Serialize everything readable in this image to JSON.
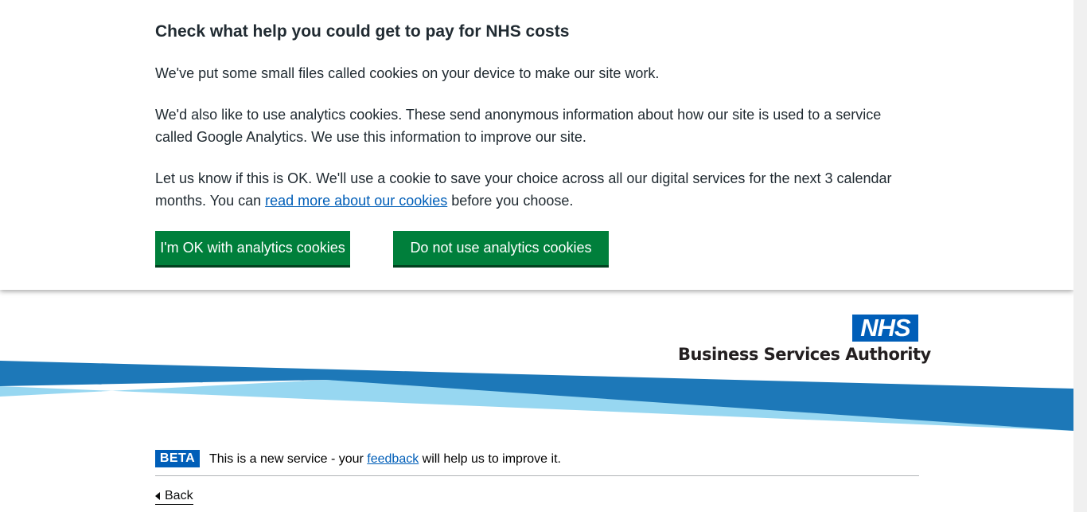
{
  "cookie_banner": {
    "title": "Check what help you could get to pay for NHS costs",
    "paragraph_1": "We've put some small files called cookies on your device to make our site work.",
    "paragraph_2": "We'd also like to use analytics cookies. These send anonymous information about how our site is used to a service called Google Analytics. We use this information to improve our site.",
    "paragraph_3_before": "Let us know if this is OK. We'll use a cookie to save your choice across all our digital services for the next 3 calendar months. You can ",
    "paragraph_3_link": "read more about our cookies",
    "paragraph_3_after": " before you choose.",
    "accept_label": "I'm OK with analytics cookies",
    "reject_label": "Do not use analytics cookies"
  },
  "header": {
    "logo_text": "NHS",
    "org_name": "Business Services Authority"
  },
  "phase_banner": {
    "tag": "BETA",
    "text_before": "This is a new service - your ",
    "link": "feedback",
    "text_after": " will help us to improve it."
  },
  "navigation": {
    "back_label": "Back"
  },
  "colors": {
    "nhs_blue": "#005eb8",
    "button_green": "#007f3b",
    "text": "#212b32"
  }
}
